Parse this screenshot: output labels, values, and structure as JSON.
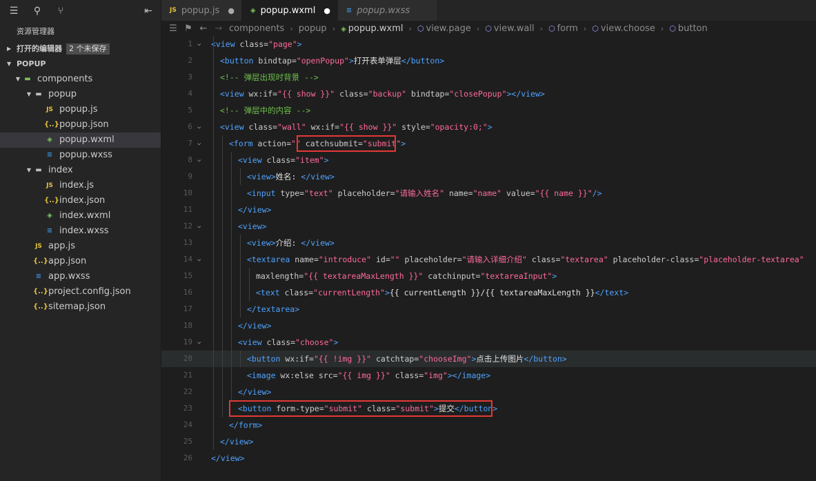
{
  "sidebar": {
    "title": "资源管理器",
    "open_editors": {
      "label": "打开的编辑器",
      "badge": "2 个未保存"
    },
    "project": {
      "label": "POPUP"
    },
    "tree": [
      {
        "label": "components",
        "icon": "folder-green",
        "depth": 0,
        "caret": "▼"
      },
      {
        "label": "popup",
        "icon": "folder",
        "depth": 1,
        "caret": "▼"
      },
      {
        "label": "popup.js",
        "icon": "js",
        "depth": 2
      },
      {
        "label": "popup.json",
        "icon": "json",
        "depth": 2
      },
      {
        "label": "popup.wxml",
        "icon": "wxml",
        "depth": 2,
        "selected": true
      },
      {
        "label": "popup.wxss",
        "icon": "wxss",
        "depth": 2
      },
      {
        "label": "index",
        "icon": "folder",
        "depth": 1,
        "caret": "▼"
      },
      {
        "label": "index.js",
        "icon": "js",
        "depth": 2
      },
      {
        "label": "index.json",
        "icon": "json",
        "depth": 2
      },
      {
        "label": "index.wxml",
        "icon": "wxml",
        "depth": 2
      },
      {
        "label": "index.wxss",
        "icon": "wxss",
        "depth": 2
      },
      {
        "label": "app.js",
        "icon": "js",
        "depth": 1
      },
      {
        "label": "app.json",
        "icon": "json",
        "depth": 1
      },
      {
        "label": "app.wxss",
        "icon": "wxss",
        "depth": 1
      },
      {
        "label": "project.config.json",
        "icon": "json",
        "depth": 1
      },
      {
        "label": "sitemap.json",
        "icon": "json",
        "depth": 1
      }
    ]
  },
  "tabs": [
    {
      "label": "popup.js",
      "icon": "js",
      "dirty": true,
      "active": false,
      "italic": false
    },
    {
      "label": "popup.wxml",
      "icon": "wxml",
      "dirty": true,
      "active": true,
      "italic": false
    },
    {
      "label": "popup.wxss",
      "icon": "wxss",
      "dirty": false,
      "active": false,
      "italic": true
    }
  ],
  "breadcrumb": [
    "components",
    "popup",
    "popup.wxml",
    "view.page",
    "view.wall",
    "form",
    "view.choose",
    "button"
  ],
  "code_lines": [
    {
      "n": "1",
      "fold": true,
      "indent": 0,
      "tokens": [
        [
          "t-tag",
          "<view "
        ],
        [
          "t-attr",
          "class="
        ],
        [
          "t-str",
          "\"page\""
        ],
        [
          "t-tag",
          ">"
        ]
      ]
    },
    {
      "n": "2",
      "indent": 1,
      "tokens": [
        [
          "t-tag",
          "<button "
        ],
        [
          "t-attr",
          "bindtap="
        ],
        [
          "t-str",
          "\"openPopup\""
        ],
        [
          "t-tag",
          ">"
        ],
        [
          "t-txt",
          "打开表单弹层"
        ],
        [
          "t-tag",
          "</button>"
        ]
      ]
    },
    {
      "n": "3",
      "indent": 1,
      "tokens": [
        [
          "t-com",
          "<!-- 弹层出现时背景 -->"
        ]
      ]
    },
    {
      "n": "4",
      "indent": 1,
      "tokens": [
        [
          "t-tag",
          "<view "
        ],
        [
          "t-attr",
          "wx:if="
        ],
        [
          "t-str",
          "\"{{ "
        ],
        [
          "t-exp",
          "show"
        ],
        [
          "t-str",
          " }}\""
        ],
        [
          "t-attr",
          " class="
        ],
        [
          "t-str",
          "\"backup\""
        ],
        [
          "t-attr",
          " bindtap="
        ],
        [
          "t-str",
          "\"closePopup\""
        ],
        [
          "t-tag",
          "></view>"
        ]
      ]
    },
    {
      "n": "5",
      "indent": 1,
      "tokens": [
        [
          "t-com",
          "<!-- 弹层中的内容 -->"
        ]
      ]
    },
    {
      "n": "6",
      "fold": true,
      "indent": 1,
      "tokens": [
        [
          "t-tag",
          "<view "
        ],
        [
          "t-attr",
          "class="
        ],
        [
          "t-str",
          "\"wall\""
        ],
        [
          "t-attr",
          " wx:if="
        ],
        [
          "t-str",
          "\"{{ "
        ],
        [
          "t-exp",
          "show"
        ],
        [
          "t-str",
          " }}\""
        ],
        [
          "t-attr",
          " style="
        ],
        [
          "t-str",
          "\"opacity:0;\""
        ],
        [
          "t-tag",
          ">"
        ]
      ]
    },
    {
      "n": "7",
      "fold": true,
      "indent": 2,
      "tokens": [
        [
          "t-tag",
          "<form "
        ],
        [
          "t-attr",
          "action="
        ],
        [
          "t-str",
          "\"\""
        ],
        [
          "t-attr",
          " catchsubmit="
        ],
        [
          "t-str",
          "\"submit\""
        ],
        [
          "t-tag",
          ">"
        ]
      ]
    },
    {
      "n": "8",
      "fold": true,
      "indent": 3,
      "tokens": [
        [
          "t-tag",
          "<view "
        ],
        [
          "t-attr",
          "class="
        ],
        [
          "t-str",
          "\"item\""
        ],
        [
          "t-tag",
          ">"
        ]
      ]
    },
    {
      "n": "9",
      "indent": 4,
      "tokens": [
        [
          "t-tag",
          "<view>"
        ],
        [
          "t-txt",
          "姓名: "
        ],
        [
          "t-tag",
          "</view>"
        ]
      ]
    },
    {
      "n": "10",
      "indent": 4,
      "tokens": [
        [
          "t-tag",
          "<input "
        ],
        [
          "t-attr",
          "type="
        ],
        [
          "t-str",
          "\"text\""
        ],
        [
          "t-attr",
          " placeholder="
        ],
        [
          "t-str",
          "\"请输入姓名\""
        ],
        [
          "t-attr",
          " name="
        ],
        [
          "t-str",
          "\"name\""
        ],
        [
          "t-attr",
          " value="
        ],
        [
          "t-str",
          "\"{{ "
        ],
        [
          "t-exp",
          "name"
        ],
        [
          "t-str",
          " }}\""
        ],
        [
          "t-tag",
          "/>"
        ]
      ]
    },
    {
      "n": "11",
      "indent": 3,
      "tokens": [
        [
          "t-tag",
          "</view>"
        ]
      ]
    },
    {
      "n": "12",
      "fold": true,
      "indent": 3,
      "tokens": [
        [
          "t-tag",
          "<view>"
        ]
      ]
    },
    {
      "n": "13",
      "indent": 4,
      "tokens": [
        [
          "t-tag",
          "<view>"
        ],
        [
          "t-txt",
          "介绍: "
        ],
        [
          "t-tag",
          "</view>"
        ]
      ]
    },
    {
      "n": "14",
      "fold": true,
      "indent": 4,
      "tokens": [
        [
          "t-tag",
          "<textarea "
        ],
        [
          "t-attr",
          "name="
        ],
        [
          "t-str",
          "\"introduce\""
        ],
        [
          "t-attr",
          " id="
        ],
        [
          "t-str",
          "\"\""
        ],
        [
          "t-attr",
          " placeholder="
        ],
        [
          "t-str",
          "\"请输入详细介绍\""
        ],
        [
          "t-attr",
          " class="
        ],
        [
          "t-str",
          "\"textarea\""
        ],
        [
          "t-attr",
          " placeholder-class="
        ],
        [
          "t-str",
          "\"placeholder-textarea\""
        ]
      ]
    },
    {
      "n": "15",
      "indent": 5,
      "tokens": [
        [
          "t-attr",
          "maxlength="
        ],
        [
          "t-str",
          "\"{{ "
        ],
        [
          "t-exp",
          "textareaMaxLength"
        ],
        [
          "t-str",
          " }}\""
        ],
        [
          "t-attr",
          " catchinput="
        ],
        [
          "t-str",
          "\"textareaInput\""
        ],
        [
          "t-tag",
          ">"
        ]
      ]
    },
    {
      "n": "16",
      "indent": 5,
      "tokens": [
        [
          "t-tag",
          "<text "
        ],
        [
          "t-attr",
          "class="
        ],
        [
          "t-str",
          "\"currentLength\""
        ],
        [
          "t-tag",
          ">"
        ],
        [
          "t-txt",
          "{{ currentLength }}/{{ textareaMaxLength }}"
        ],
        [
          "t-tag",
          "</text>"
        ]
      ]
    },
    {
      "n": "17",
      "indent": 4,
      "tokens": [
        [
          "t-tag",
          "</textarea>"
        ]
      ]
    },
    {
      "n": "18",
      "indent": 3,
      "tokens": [
        [
          "t-tag",
          "</view>"
        ]
      ]
    },
    {
      "n": "19",
      "fold": true,
      "indent": 3,
      "tokens": [
        [
          "t-tag",
          "<view "
        ],
        [
          "t-attr",
          "class="
        ],
        [
          "t-str",
          "\"choose\""
        ],
        [
          "t-tag",
          ">"
        ]
      ]
    },
    {
      "n": "20",
      "indent": 4,
      "hl": true,
      "tokens": [
        [
          "t-tag",
          "<button "
        ],
        [
          "t-attr",
          "wx:if="
        ],
        [
          "t-str",
          "\"{{ "
        ],
        [
          "t-exp",
          "!img"
        ],
        [
          "t-str",
          " }}\""
        ],
        [
          "t-attr",
          " catchtap="
        ],
        [
          "t-str",
          "\"chooseImg\""
        ],
        [
          "t-tag",
          ">"
        ],
        [
          "t-txt",
          "点击上传图片"
        ],
        [
          "t-tag",
          "</button>"
        ]
      ]
    },
    {
      "n": "21",
      "indent": 4,
      "tokens": [
        [
          "t-tag",
          "<image "
        ],
        [
          "t-attr",
          "wx:else src="
        ],
        [
          "t-str",
          "\"{{ "
        ],
        [
          "t-exp",
          "img"
        ],
        [
          "t-str",
          " }}\""
        ],
        [
          "t-attr",
          " class="
        ],
        [
          "t-str",
          "\"img\""
        ],
        [
          "t-tag",
          "></image>"
        ]
      ]
    },
    {
      "n": "22",
      "indent": 3,
      "tokens": [
        [
          "t-tag",
          "</view>"
        ]
      ]
    },
    {
      "n": "23",
      "indent": 3,
      "tokens": [
        [
          "t-tag",
          "<button "
        ],
        [
          "t-attr",
          "form-type="
        ],
        [
          "t-str",
          "\"submit\""
        ],
        [
          "t-attr",
          " class="
        ],
        [
          "t-str",
          "\"submit\""
        ],
        [
          "t-tag",
          ">"
        ],
        [
          "t-txt",
          "提交"
        ],
        [
          "t-tag",
          "</button>"
        ]
      ]
    },
    {
      "n": "24",
      "indent": 2,
      "tokens": [
        [
          "t-tag",
          "</form>"
        ]
      ]
    },
    {
      "n": "25",
      "indent": 1,
      "tokens": [
        [
          "t-tag",
          "</view>"
        ]
      ]
    },
    {
      "n": "26",
      "indent": 0,
      "tokens": [
        [
          "t-tag",
          "</view>"
        ]
      ]
    }
  ],
  "colors": {
    "highlight_box": "#e53935",
    "tag": "#4fa3ff",
    "string": "#ff6a9a",
    "comment": "#6fbf4e"
  }
}
